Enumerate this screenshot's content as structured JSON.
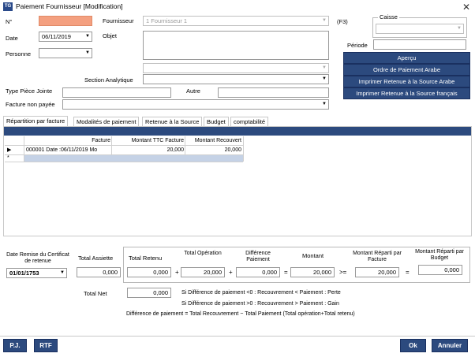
{
  "window": {
    "title": "Paiement Fournisseur [Modification]",
    "app_icon": "TG",
    "close_icon": "close-icon"
  },
  "header": {
    "num_label": "N°",
    "num_value": "",
    "date_label": "Date",
    "date_value": "06/11/2019",
    "personne_label": "Personne",
    "personne_value": "",
    "fournisseur_label": "Fournisseur",
    "fournisseur_value": "1 Fournisseur 1",
    "f3_label": "(F3)",
    "objet_label": "Objet",
    "objet_value": "",
    "section_label": "Section Analytique",
    "section_value": "",
    "type_piece_label": "Type Pièce Jointe",
    "type_piece_value": "",
    "autre_label": "Autre",
    "autre_value": "",
    "facture_label": "Facture non payée",
    "facture_value": "",
    "caisse_label": "Caisse",
    "caisse_value": "",
    "periode_label": "Période",
    "periode_value": ""
  },
  "actions": {
    "apercu": "Aperçu",
    "ordre_arabe": "Ordre de Paiement Arabe",
    "retenue_arabe": "Imprimer Retenue à la Source Arabe",
    "retenue_francais": "Imprimer Retenue à la Source français"
  },
  "tabs": [
    {
      "label": "Répartition par facture"
    },
    {
      "label": "Modalités de paiement"
    },
    {
      "label": "Retenue à la Source"
    },
    {
      "label": "Budget"
    },
    {
      "label": "comptabilité"
    }
  ],
  "grid": {
    "columns": [
      "Facture",
      "Montant TTC Facture",
      "Montant Recouvert"
    ],
    "rows": [
      {
        "indicator": "▶",
        "facture": "000001 Date :06/11/2019 Mo",
        "ttc": "20,000",
        "recouvert": "20,000"
      }
    ],
    "new_row_indicator": "*"
  },
  "totals": {
    "date_remise_label": "Date Remise du Certificat de retenue",
    "date_remise_value": "01/01/1753",
    "total_assiette_label": "Total Assiette",
    "total_assiette_value": "0,000",
    "total_retenu_label": "Total Retenu",
    "total_retenu_value": "0,000",
    "total_operation_label": "Total Opération",
    "total_operation_value": "20,000",
    "difference_label": "Différence Paiement",
    "difference_value": "0,000",
    "montant_label": "Montant",
    "montant_value": "20,000",
    "reparti_facture_label": "Montant Réparti par Facture",
    "reparti_facture_value": "20,000",
    "reparti_budget_label": "Montant Réparti par Budget",
    "reparti_budget_value": "0,000",
    "op_plus1": "+",
    "op_plus2": "+",
    "op_eq1": "=",
    "op_gte": ">=",
    "op_eq2": "=",
    "total_net_label": "Total Net",
    "total_net_value": "0,000",
    "note1": "Si Différence de paiement <0 : Recouvrement < Paiement : Perte",
    "note2": "Si Différence de paiement >0 : Recouvrement > Paiement : Gain",
    "note3": "Différence de paiement = Total Recouvrement − Total Paiement (Total opération+Total retenu)"
  },
  "footer": {
    "pj": "P.J.",
    "rtf": "RTF",
    "ok": "Ok",
    "annuler": "Annuler"
  },
  "colors": {
    "accent": "#2c4a7e",
    "num_field": "#f4a080"
  }
}
